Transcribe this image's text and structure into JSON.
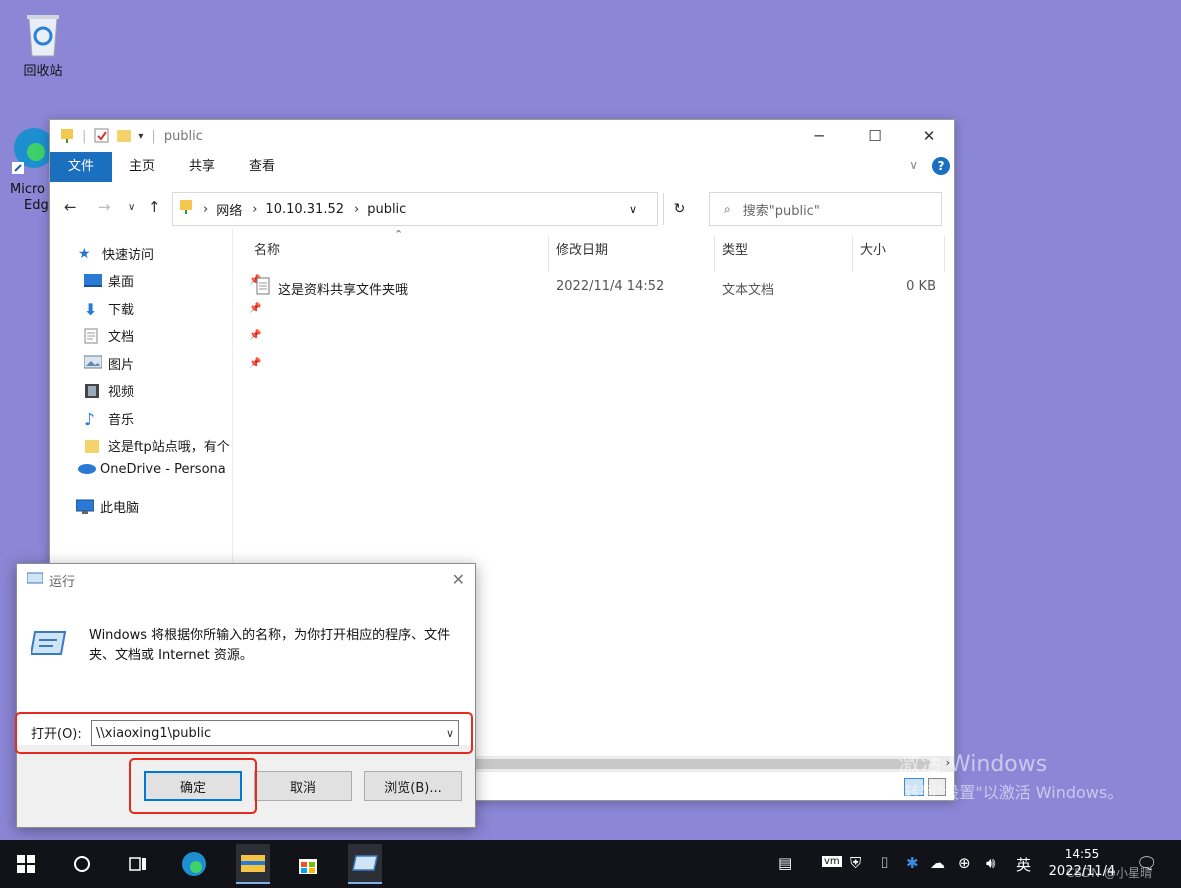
{
  "desktop": {
    "recycle_bin_label": "回收站",
    "edge_label_line1": "Micro",
    "edge_label_line2": "Edg"
  },
  "explorer": {
    "title": "public",
    "ribbon_tabs": [
      "文件",
      "主页",
      "共享",
      "查看"
    ],
    "address": {
      "crumbs": [
        "网络",
        "10.10.31.52",
        "public"
      ]
    },
    "search_placeholder": "搜索\"public\"",
    "nav_pane": {
      "quick_access": "快速访问",
      "items": [
        "桌面",
        "下载",
        "文档",
        "图片",
        "视频",
        "音乐",
        "这是ftp站点哦，有个"
      ],
      "onedrive": "OneDrive - Persona",
      "this_pc": "此电脑"
    },
    "columns": {
      "name": "名称",
      "modified": "修改日期",
      "type": "类型",
      "size": "大小"
    },
    "files": [
      {
        "name": "这是资料共享文件夹哦",
        "modified": "2022/11/4 14:52",
        "type": "文本文档",
        "size": "0 KB"
      }
    ]
  },
  "watermark": {
    "line1": "激活 Windows",
    "line2": "转到\"设置\"以激活 Windows。"
  },
  "run_dialog": {
    "title": "运行",
    "description": "Windows 将根据你所输入的名称，为你打开相应的程序、文件夹、文档或 Internet 资源。",
    "open_label": "打开(O):",
    "open_value": "\\\\xiaoxing1\\public",
    "ok_label": "确定",
    "cancel_label": "取消",
    "browse_label": "浏览(B)..."
  },
  "taskbar": {
    "ime": "英",
    "time": "14:55",
    "date": "2022/11/4",
    "csdn_watermark": "CSDN @小星晴"
  },
  "colors": {
    "desktop_bg": "#8b86d6",
    "ribbon_file_tab": "#1a6fbf",
    "highlight_red": "#e52a1e",
    "taskbar_bg": "#111318"
  }
}
